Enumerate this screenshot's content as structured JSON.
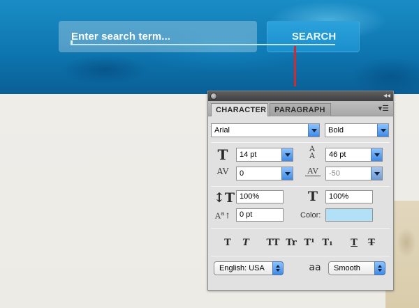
{
  "search": {
    "placeholder": "Enter search term...",
    "button_label": "SEARCH"
  },
  "colors": {
    "hero_blue": "#0e76b0",
    "button_blue": "#1b8fcc",
    "marker_red": "#d12a2f",
    "swatch": "#b2e1f7"
  },
  "panel": {
    "tabs": [
      {
        "label": "CHARACTER",
        "active": true
      },
      {
        "label": "PARAGRAPH",
        "active": false
      }
    ],
    "font_family": "Arial",
    "font_style": "Bold",
    "font_size": "14 pt",
    "leading": "46 pt",
    "kerning": "0",
    "tracking": "-50",
    "vertical_scale": "100%",
    "horizontal_scale": "100%",
    "baseline_shift": "0 pt",
    "color_label": "Color:",
    "style_buttons": [
      "T",
      "T",
      "TT",
      "Tr",
      "T¹",
      "T₁",
      "T",
      "T"
    ],
    "language": "English: USA",
    "antialias_icon_text": "aa",
    "antialias": "Smooth",
    "icons": {
      "close": "close-icon",
      "collapse": "collapse-icon",
      "menu": "panel-menu-icon",
      "font_size": "font-size-icon",
      "leading": "leading-icon",
      "kerning": "kerning-icon",
      "tracking": "tracking-icon",
      "vertical_scale": "vertical-scale-icon",
      "horizontal_scale": "horizontal-scale-icon",
      "baseline_shift": "baseline-shift-icon",
      "antialias": "antialias-icon"
    }
  }
}
